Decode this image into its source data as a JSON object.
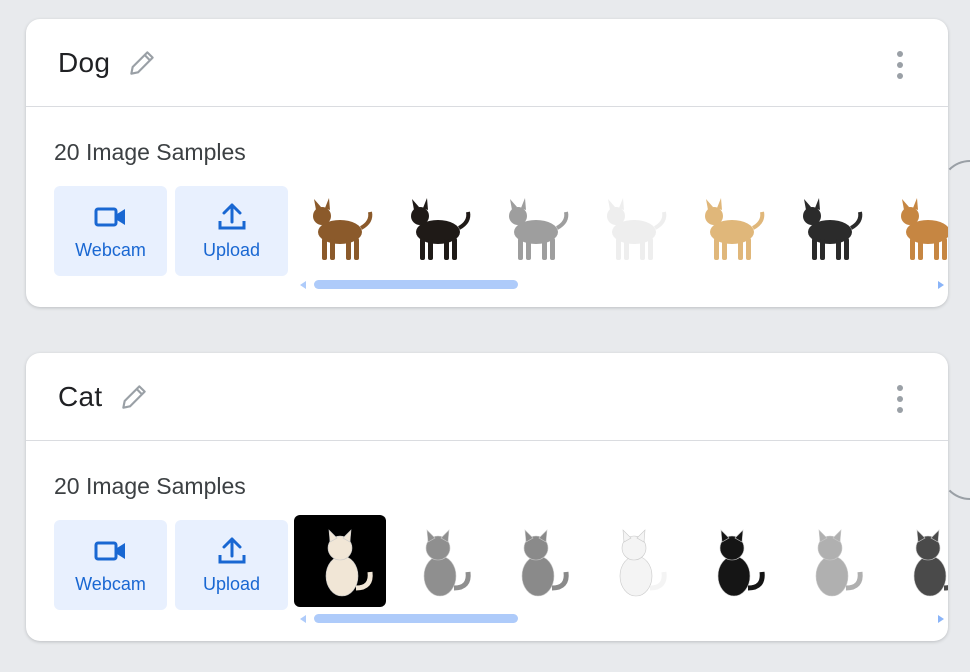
{
  "classes": [
    {
      "name": "Dog",
      "samples_label": "20 Image Samples",
      "webcam_label": "Webcam",
      "upload_label": "Upload",
      "thumbnails": [
        {
          "icon": "german-shepherd",
          "color": "#8b5a2b"
        },
        {
          "icon": "rottweiler",
          "color": "#1f1a17"
        },
        {
          "icon": "husky",
          "color": "#9e9e9e"
        },
        {
          "icon": "white-poodle",
          "color": "#eeeeee"
        },
        {
          "icon": "golden-puppy",
          "color": "#e0b77a"
        },
        {
          "icon": "border-collie",
          "color": "#2b2b2b"
        },
        {
          "icon": "shiba",
          "color": "#c68642"
        }
      ]
    },
    {
      "name": "Cat",
      "samples_label": "20 Image Samples",
      "webcam_label": "Webcam",
      "upload_label": "Upload",
      "thumbnails": [
        {
          "icon": "fluffy-cat",
          "color": "#f1e6d6"
        },
        {
          "icon": "ragdoll-cat",
          "color": "#8f8f8f"
        },
        {
          "icon": "grey-cat",
          "color": "#8a8a8a"
        },
        {
          "icon": "white-cat",
          "color": "#f4f4f4"
        },
        {
          "icon": "tuxedo-cat",
          "color": "#151515"
        },
        {
          "icon": "kitten",
          "color": "#b0b0b0"
        },
        {
          "icon": "tabby-cat",
          "color": "#4a4a4a"
        }
      ]
    }
  ],
  "colors": {
    "accent": "#1967d2",
    "button_bg": "#e8f0fe",
    "scrollbar": "#aecbfa"
  }
}
